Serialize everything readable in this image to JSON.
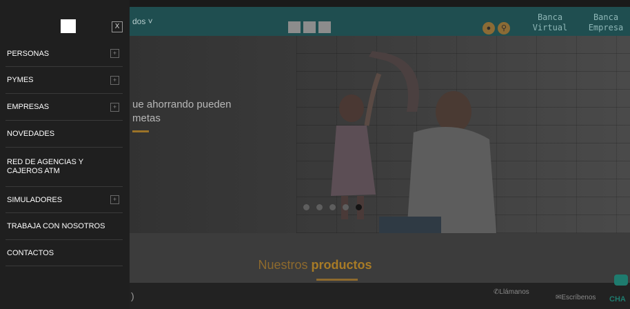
{
  "header": {
    "menu_fragment": "dos ˅",
    "banca_virtual": [
      "Banca",
      "Virtual"
    ],
    "banca_empresa": [
      "Banca",
      "Empresa"
    ]
  },
  "hero": {
    "text_line1": "ue ahorrando pueden",
    "text_line2": "metas",
    "slide_count": 5,
    "active_slide": 5
  },
  "products": {
    "prefix": "Nuestros",
    "bold": "productos"
  },
  "footer": {
    "call": "Llámanos",
    "write": "Escríbenos",
    "chat": "CHA"
  },
  "drawer": {
    "close_label": "X",
    "items": [
      {
        "label": "PERSONAS",
        "expandable": true
      },
      {
        "label": "PYMES",
        "expandable": true
      },
      {
        "label": "EMPRESAS",
        "expandable": true
      },
      {
        "label": "NOVEDADES",
        "expandable": false
      },
      {
        "label": "RED DE AGENCIAS Y",
        "label2": "CAJEROS ATM",
        "expandable": false
      },
      {
        "label": "SIMULADORES",
        "expandable": true
      },
      {
        "label": "TRABAJA CON NOSOTROS",
        "expandable": false
      },
      {
        "label": "CONTACTOS",
        "expandable": false
      }
    ]
  },
  "colors": {
    "header_teal": "#1f4e50",
    "accent_gold": "#a87b26",
    "drawer_bg": "#1f1f1f"
  }
}
